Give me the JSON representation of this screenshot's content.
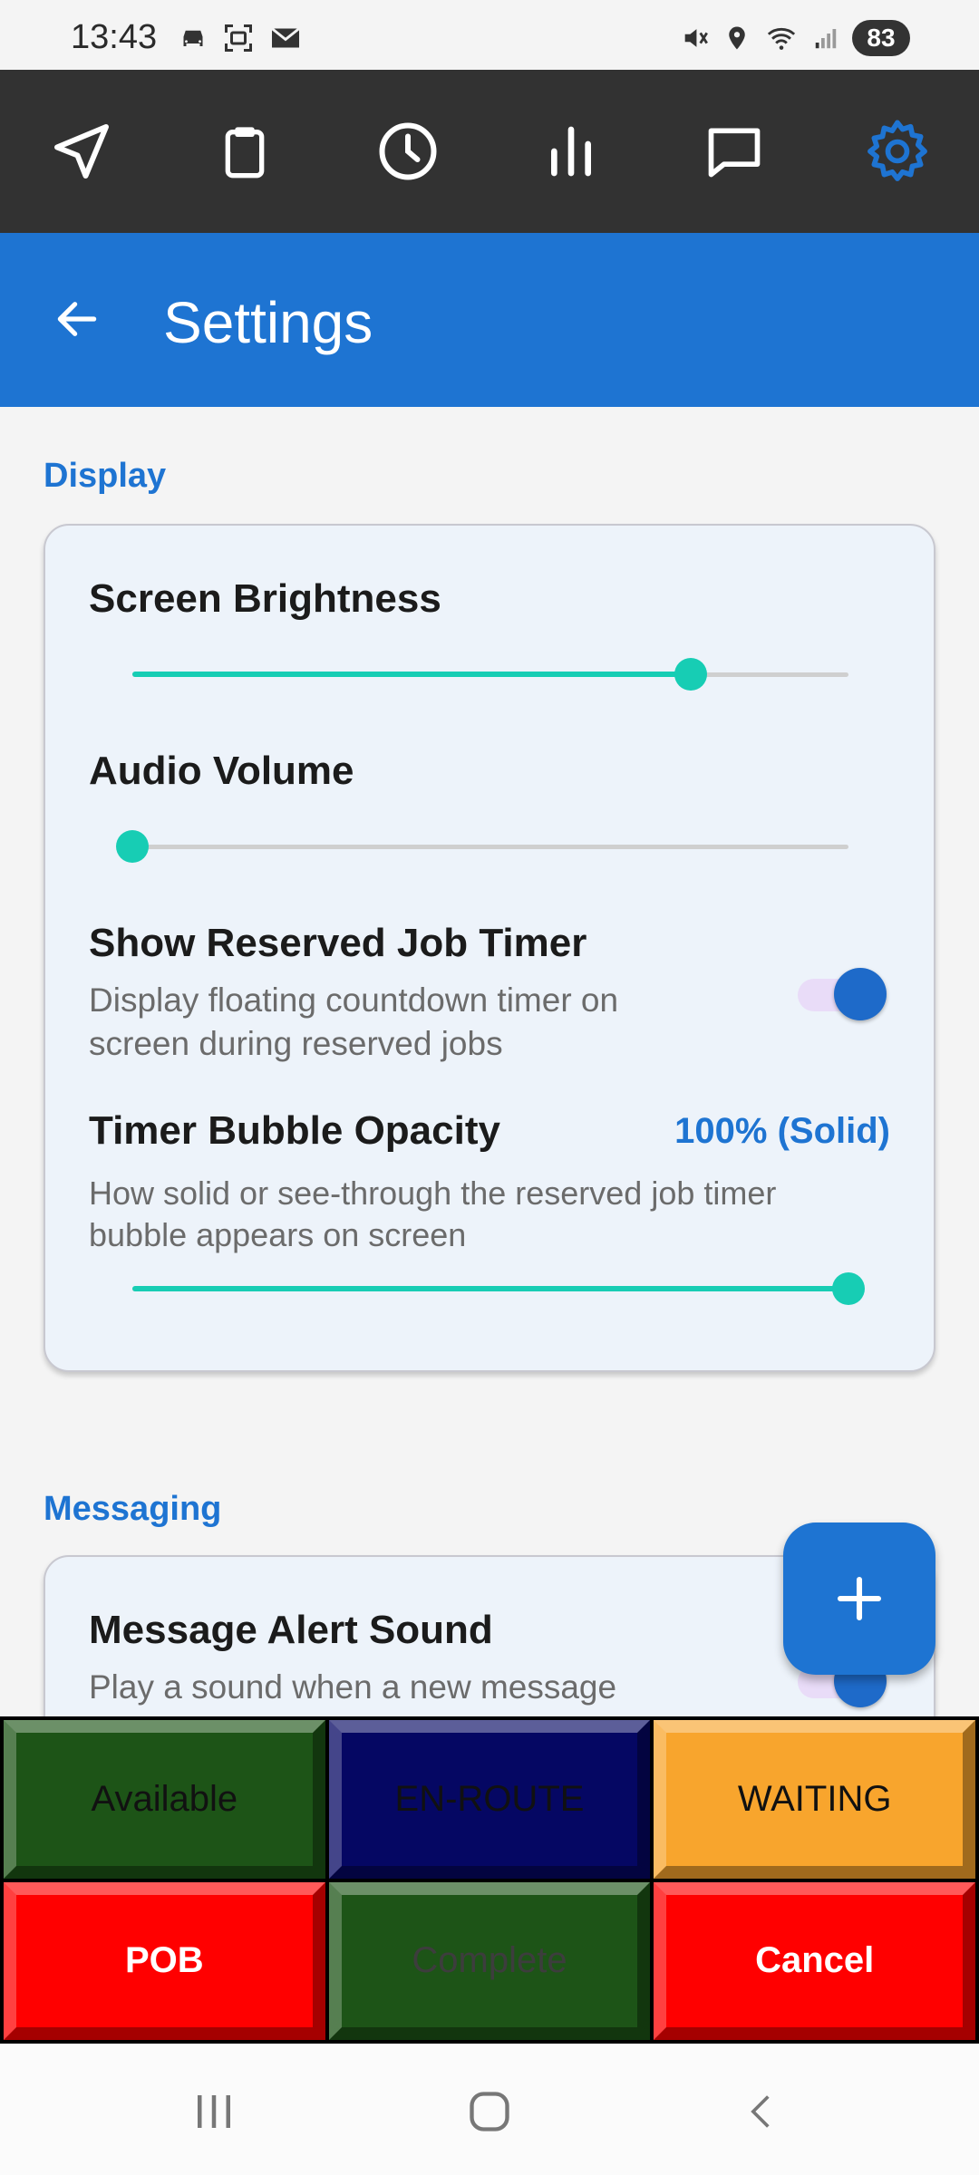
{
  "status_bar": {
    "time": "13:43",
    "battery": "83"
  },
  "top_nav": {
    "items": [
      "navigate-icon",
      "clipboard-icon",
      "clock-icon",
      "bar-chart-icon",
      "chat-icon",
      "gear-icon"
    ],
    "active": "gear-icon",
    "active_color": "#1e74d2"
  },
  "app_bar": {
    "title": "Settings",
    "color": "#1e74d2"
  },
  "display_section": {
    "title": "Display",
    "screen_brightness": {
      "label": "Screen Brightness",
      "value": 0.78
    },
    "audio_volume": {
      "label": "Audio Volume",
      "value": 0.0
    },
    "reserved_job_timer": {
      "label": "Show Reserved Job Timer",
      "desc_line1": "Display floating countdown timer on",
      "desc_line2": "screen during reserved jobs",
      "enabled": true
    },
    "timer_opacity": {
      "label": "Timer Bubble Opacity",
      "value_text": "100% (Solid)",
      "desc_line1": "How solid or see-through the reserved job timer",
      "desc_line2": "bubble appears on screen",
      "value": 1.0
    }
  },
  "messaging_section": {
    "title": "Messaging",
    "alert_sound": {
      "label": "Message Alert Sound",
      "desc_line1": "Play a sound when a new message"
    }
  },
  "status_buttons": {
    "available": "Available",
    "en_route": "EN-ROUTE",
    "waiting": "WAITING",
    "pob": "POB",
    "complete": "Complete",
    "cancel": "Cancel"
  }
}
